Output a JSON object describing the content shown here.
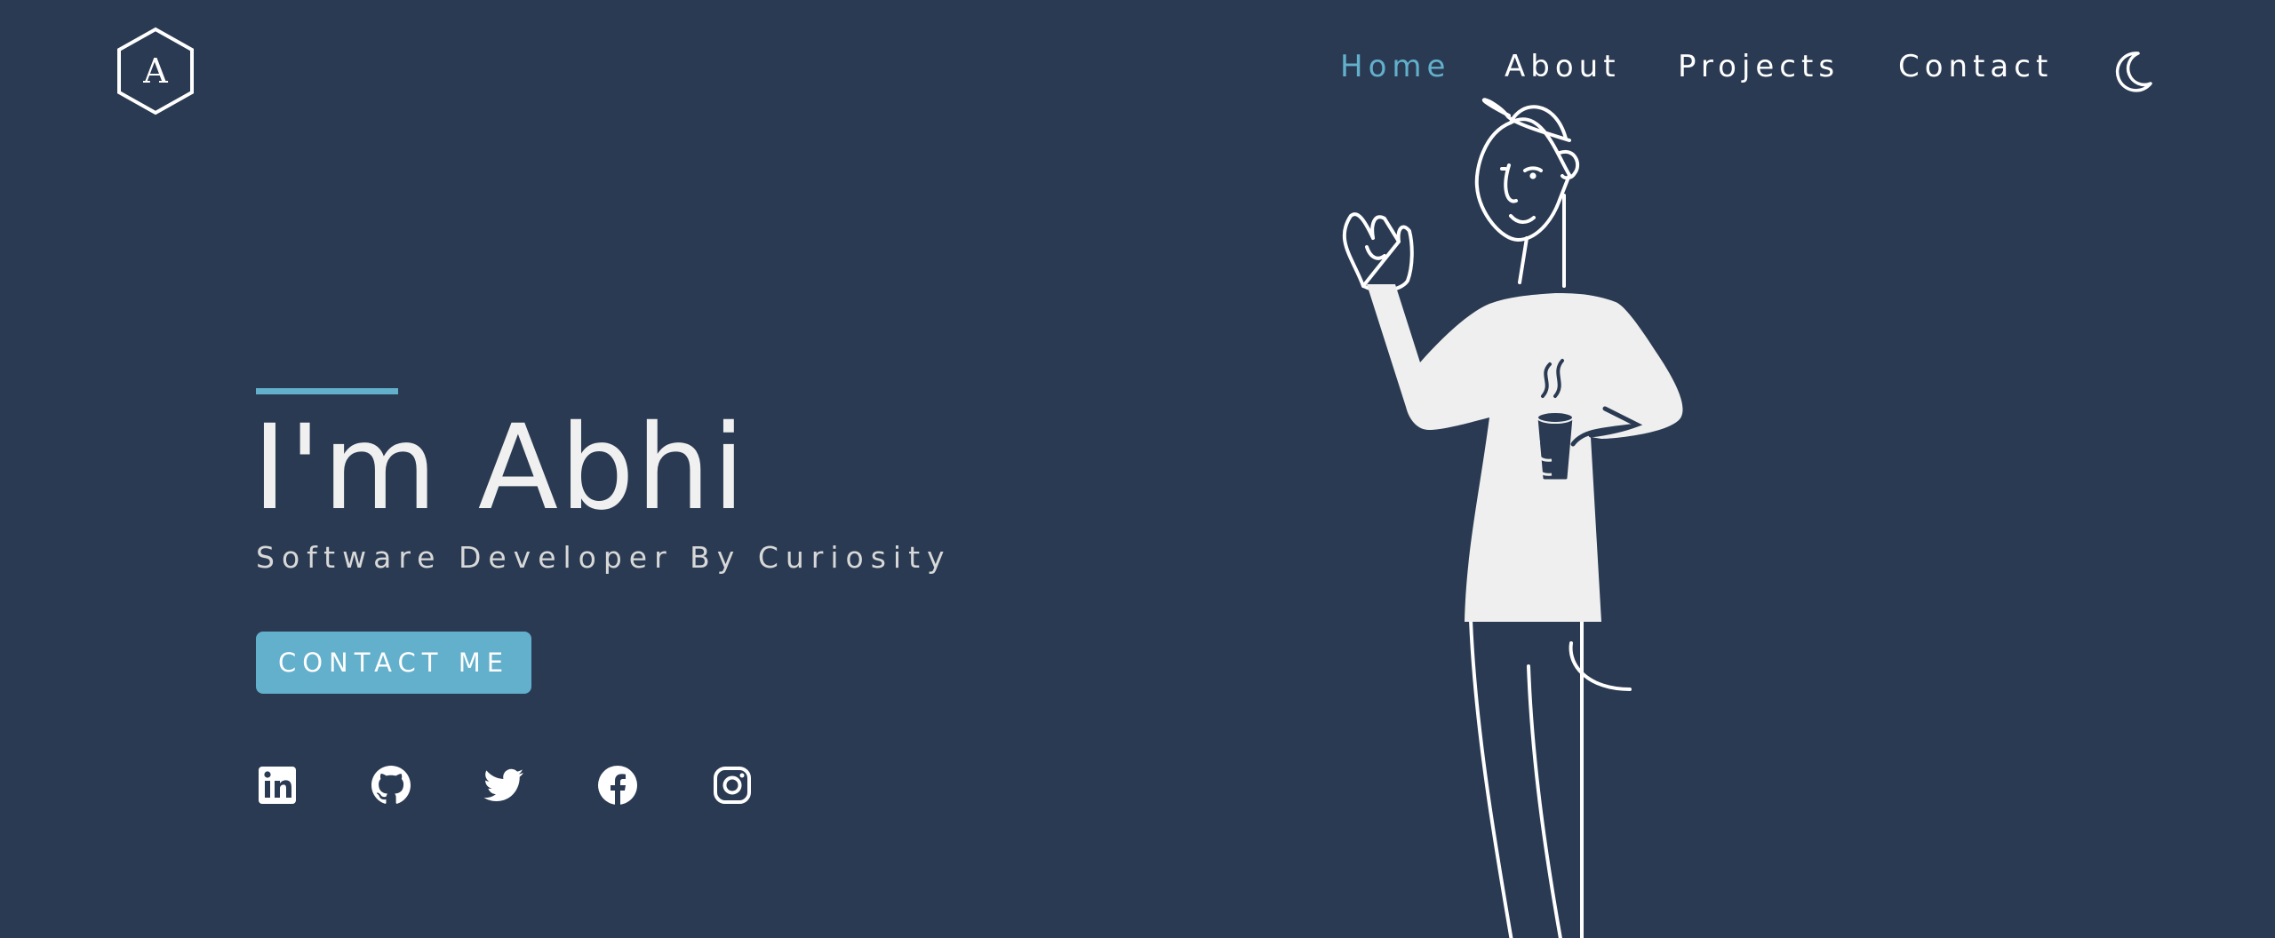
{
  "logo": {
    "letter": "A",
    "icon": "hexagon-logo-icon"
  },
  "nav": {
    "items": [
      {
        "label": "Home",
        "active": true
      },
      {
        "label": "About",
        "active": false
      },
      {
        "label": "Projects",
        "active": false
      },
      {
        "label": "Contact",
        "active": false
      }
    ],
    "theme_toggle_icon": "moon-icon"
  },
  "hero": {
    "title": "I'm Abhi",
    "subtitle": "Software Developer By Curiosity",
    "cta_label": "CONTACT ME"
  },
  "social": [
    {
      "name": "linkedin",
      "icon": "linkedin-icon"
    },
    {
      "name": "github",
      "icon": "github-icon"
    },
    {
      "name": "twitter",
      "icon": "twitter-icon"
    },
    {
      "name": "facebook",
      "icon": "facebook-icon"
    },
    {
      "name": "instagram",
      "icon": "instagram-icon"
    }
  ],
  "illustration": {
    "icon": "person-with-coffee-illustration"
  },
  "colors": {
    "background": "#2a3a52",
    "accent": "#63b0cc",
    "text": "#f0f0f0",
    "muted_text": "#d8d8d8"
  }
}
